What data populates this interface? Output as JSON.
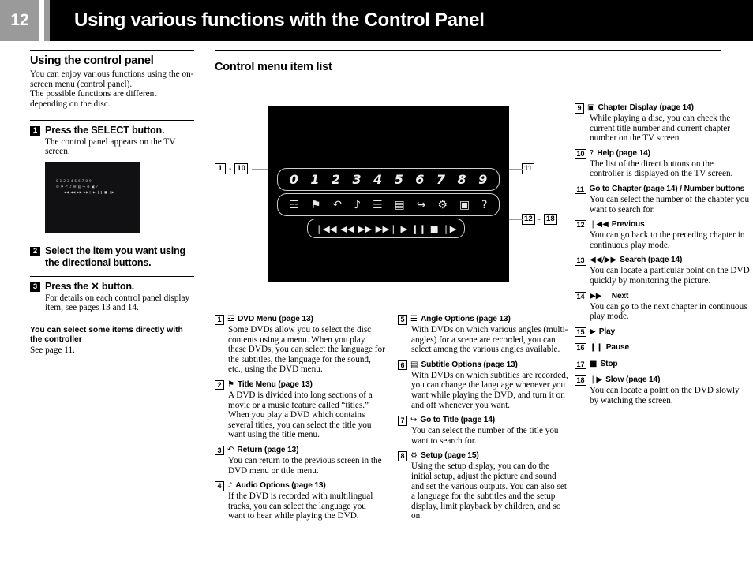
{
  "header": {
    "page_number": "12",
    "title": "Using various functions with the Control Panel"
  },
  "left_column": {
    "heading": "Using the control panel",
    "intro": "You can enjoy various functions using the on-screen menu (control panel).\nThe possible functions are different depending on the disc.",
    "steps": [
      {
        "num": "1",
        "title": "Press the SELECT button.",
        "desc": "The control panel appears on the TV screen."
      },
      {
        "num": "2",
        "title": "Select the item you want using the directional buttons.",
        "desc": ""
      },
      {
        "num": "3",
        "title": "Press the ✕ button.",
        "desc": "For details on each control panel display item, see pages 13 and 14."
      }
    ],
    "tv_screenshot": {
      "name": "control-panel-on-tv-screen",
      "row_digits": [
        "0",
        "1",
        "2",
        "3",
        "4",
        "5",
        "6",
        "7",
        "8",
        "9"
      ],
      "row_icons": [
        "☲",
        "⚑",
        "↶",
        "♪",
        "☰",
        "▤",
        "↪",
        "⚙",
        "▣",
        "?"
      ],
      "row_controls": [
        "❘◀◀",
        "◀◀",
        "▶▶",
        "▶▶❘",
        "▶",
        "❙❙",
        "■",
        "❘▶"
      ]
    },
    "note": {
      "title": "You can select some items directly with the controller",
      "body": "See page 11."
    }
  },
  "main": {
    "heading": "Control menu item list",
    "diagram": {
      "name": "control-panel-diagram",
      "row_digits": [
        "0",
        "1",
        "2",
        "3",
        "4",
        "5",
        "6",
        "7",
        "8",
        "9"
      ],
      "row_icons": [
        "☲",
        "⚑",
        "↶",
        "♪",
        "☰",
        "▤",
        "↪",
        "⚙",
        "▣",
        "?"
      ],
      "row_controls": [
        "❘◀◀",
        "◀◀",
        "▶▶",
        "▶▶❘",
        "▶",
        "❙❙",
        "■",
        "❘▶"
      ],
      "callouts": {
        "left": {
          "from": "1",
          "dash": "-",
          "to": "10"
        },
        "right_top": {
          "value": "11"
        },
        "right_bottom": {
          "from": "12",
          "dash": "-",
          "to": "18"
        }
      }
    }
  },
  "items": {
    "column1": [
      {
        "num": "1",
        "icon": "☲",
        "icon_name": "dvd-menu-icon",
        "label": "DVD Menu (page 13)",
        "body": "Some DVDs allow you to select the disc contents using a menu.  When you play these DVDs, you can select the language for the subtitles, the language for the sound, etc., using the DVD menu."
      },
      {
        "num": "2",
        "icon": "⚑",
        "icon_name": "title-menu-icon",
        "label": "Title Menu (page 13)",
        "body": "A DVD is divided into long sections of a movie or a music feature called “titles.” When you play a DVD which contains several titles, you can select the title you want using the title menu."
      },
      {
        "num": "3",
        "icon": "↶",
        "icon_name": "return-icon",
        "label": "Return (page 13)",
        "body": "You can return to the previous screen in the DVD menu or title menu."
      },
      {
        "num": "4",
        "icon": "♪",
        "icon_name": "audio-options-icon",
        "label": "Audio Options (page 13)",
        "body": "If the DVD is recorded with multilingual tracks, you can select the language you want to hear while playing the DVD."
      }
    ],
    "column2": [
      {
        "num": "5",
        "icon": "☰",
        "icon_name": "angle-options-icon",
        "label": "Angle Options (page 13)",
        "body": "With DVDs on which various angles (multi-angles) for a scene are recorded, you can select among the various angles available."
      },
      {
        "num": "6",
        "icon": "▤",
        "icon_name": "subtitle-options-icon",
        "label": "Subtitle Options (page 13)",
        "body": "With DVDs on which subtitles are recorded, you can change the language whenever you want while playing the DVD, and turn it on and off whenever you want."
      },
      {
        "num": "7",
        "icon": "↪",
        "icon_name": "go-to-title-icon",
        "label": "Go to Title (page 14)",
        "body": "You can select the number of the title you want to search for."
      },
      {
        "num": "8",
        "icon": "⚙",
        "icon_name": "setup-icon",
        "label": "Setup (page 15)",
        "body": "Using the setup display, you can do the initial setup, adjust the picture and sound and set the various outputs.  You can also set a language for the subtitles and the setup display, limit playback by children, and so on."
      }
    ],
    "column3": [
      {
        "num": "9",
        "icon": "▣",
        "icon_name": "chapter-display-icon",
        "label": "Chapter Display (page 14)",
        "body": "While playing a disc, you can check the current title number and current chapter number on the TV screen."
      },
      {
        "num": "10",
        "icon": "?",
        "icon_name": "help-icon",
        "label": "Help (page 14)",
        "body": "The list of the direct buttons on the controller is displayed on the TV screen."
      },
      {
        "num": "11",
        "icon": "",
        "icon_name": "go-to-chapter-icon",
        "label": "Go to Chapter (page 14) / Number buttons",
        "body": "You can select the number of the chapter you want to search for."
      },
      {
        "num": "12",
        "icon": "❘◀◀",
        "icon_name": "previous-icon",
        "label": "Previous",
        "body": "You can go back to the preceding chapter in continuous play mode."
      },
      {
        "num": "13",
        "icon": "◀◀/▶▶",
        "icon_name": "search-icon",
        "label": "Search (page 14)",
        "body": "You can locate a particular point on the DVD quickly by monitoring the picture."
      },
      {
        "num": "14",
        "icon": "▶▶❘",
        "icon_name": "next-icon",
        "label": "Next",
        "body": "You can go to the next chapter in continuous play mode."
      },
      {
        "num": "15",
        "icon": "▶",
        "icon_name": "play-icon",
        "label": "Play",
        "body": ""
      },
      {
        "num": "16",
        "icon": "❙❙",
        "icon_name": "pause-icon",
        "label": "Pause",
        "body": ""
      },
      {
        "num": "17",
        "icon": "■",
        "icon_name": "stop-icon",
        "label": "Stop",
        "body": ""
      },
      {
        "num": "18",
        "icon": "❘▶",
        "icon_name": "slow-icon",
        "label": "Slow (page 14)",
        "body": "You can locate a point on the DVD slowly by watching the screen."
      }
    ]
  }
}
